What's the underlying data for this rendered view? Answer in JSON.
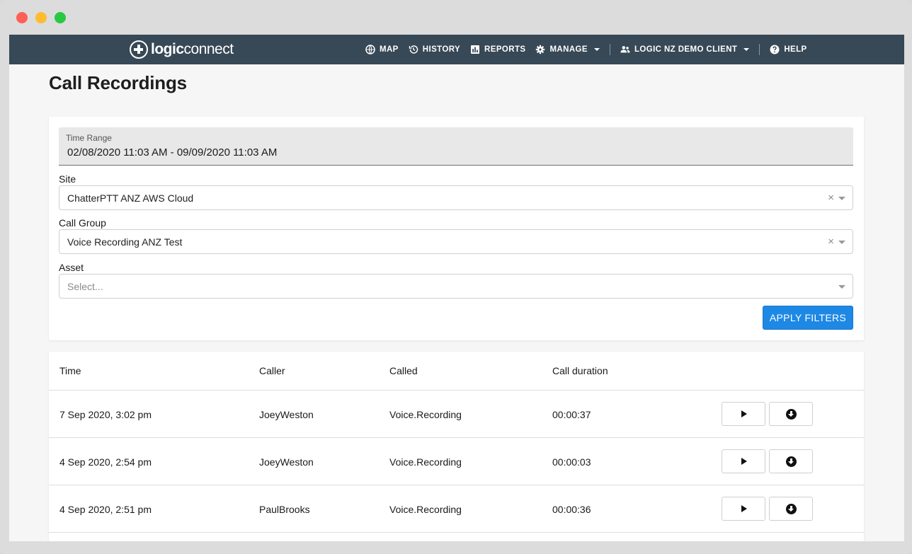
{
  "window": {
    "controls": [
      "close",
      "minimize",
      "zoom"
    ]
  },
  "brand": {
    "logo_bold": "logic",
    "logo_light": "connect",
    "logo_icon": "plus-circle-icon"
  },
  "nav": {
    "map": "MAP",
    "history": "HISTORY",
    "reports": "REPORTS",
    "manage": "MANAGE",
    "client": "LOGIC NZ DEMO CLIENT",
    "help": "HELP"
  },
  "page": {
    "title": "Call Recordings"
  },
  "filters": {
    "time_range": {
      "label": "Time Range",
      "value": "02/08/2020 11:03 AM - 09/09/2020 11:03 AM"
    },
    "site": {
      "label": "Site",
      "value": "ChatterPTT ANZ AWS Cloud"
    },
    "call_group": {
      "label": "Call Group",
      "value": "Voice Recording ANZ Test"
    },
    "asset": {
      "label": "Asset",
      "placeholder": "Select..."
    },
    "apply_label": "APPLY FILTERS",
    "clear_glyph": "×"
  },
  "table": {
    "headers": {
      "time": "Time",
      "caller": "Caller",
      "called": "Called",
      "duration": "Call duration"
    },
    "rows": [
      {
        "time": "7 Sep 2020, 3:02 pm",
        "caller": "JoeyWeston",
        "called": "Voice.Recording",
        "duration": "00:00:37"
      },
      {
        "time": "4 Sep 2020, 2:54 pm",
        "caller": "JoeyWeston",
        "called": "Voice.Recording",
        "duration": "00:00:03"
      },
      {
        "time": "4 Sep 2020, 2:51 pm",
        "caller": "PaulBrooks",
        "called": "Voice.Recording",
        "duration": "00:00:36"
      }
    ]
  },
  "colors": {
    "navbar": "#374856",
    "accent": "#1e88e5",
    "background": "#f6f6f6"
  }
}
